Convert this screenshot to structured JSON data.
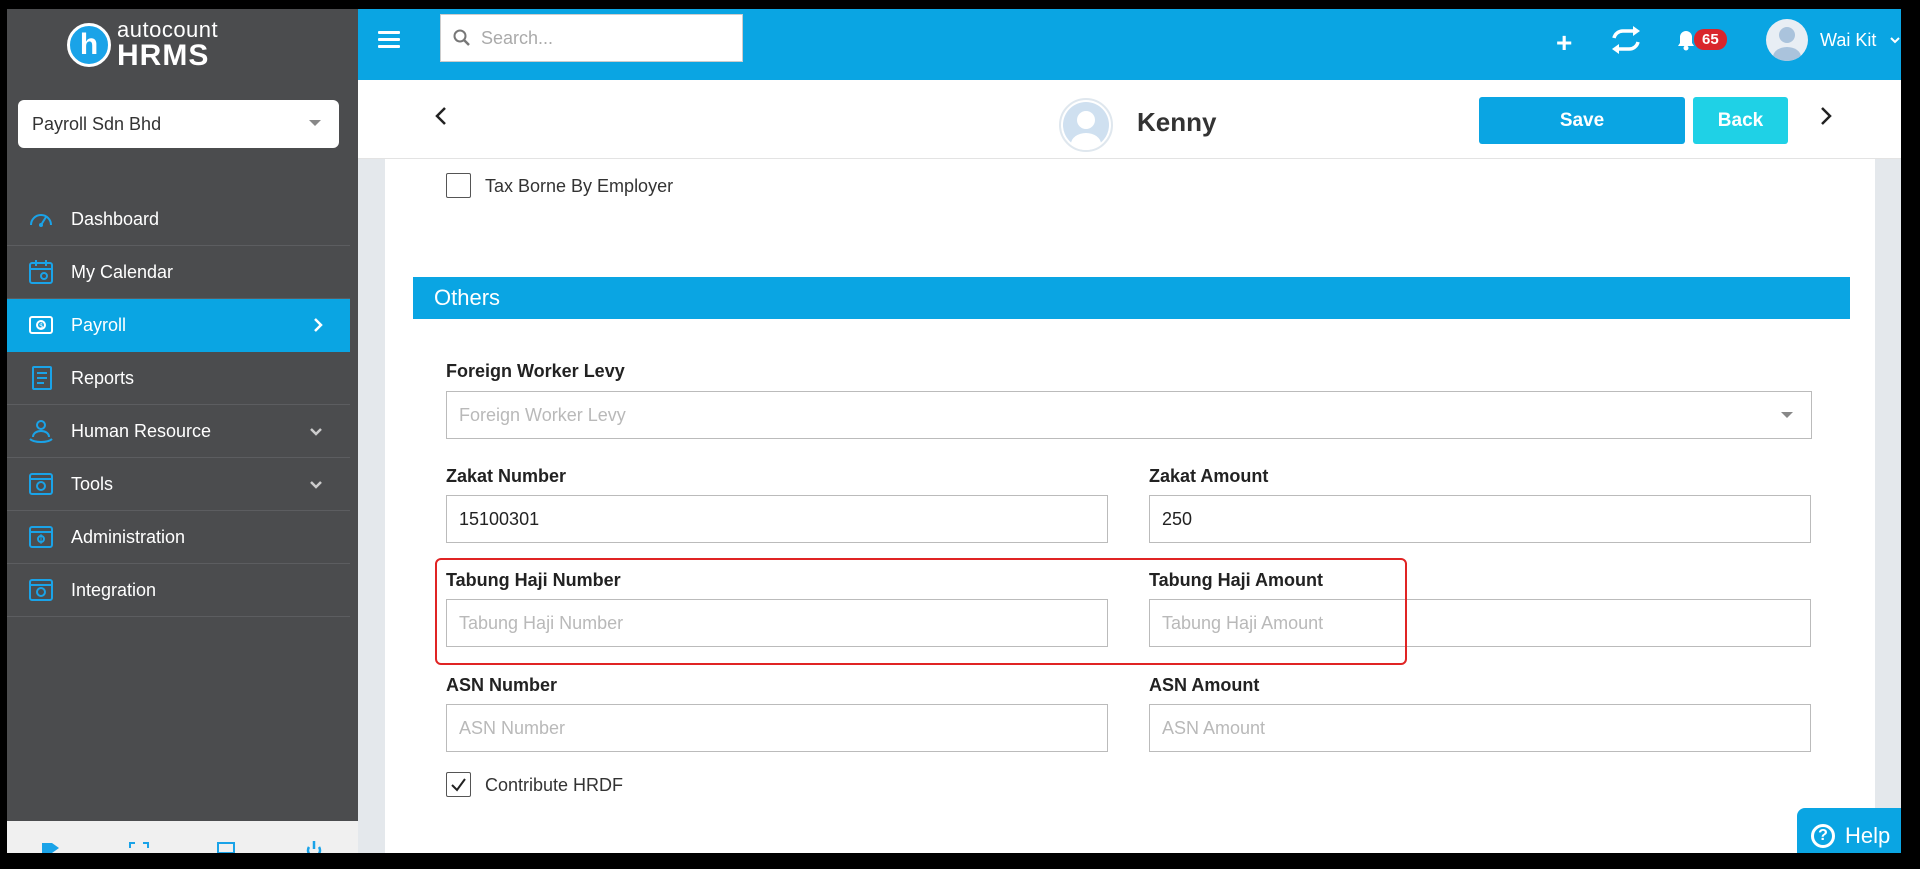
{
  "logo": {
    "top": "autocount",
    "bottom": "HRMS",
    "mark": "h"
  },
  "company": "Payroll Sdn Bhd",
  "nav": [
    {
      "label": "Dashboard",
      "icon": "dashboard-icon"
    },
    {
      "label": "My Calendar",
      "icon": "calendar-icon"
    },
    {
      "label": "Payroll",
      "icon": "payroll-icon",
      "active": true
    },
    {
      "label": "Reports",
      "icon": "reports-icon"
    },
    {
      "label": "Human Resource",
      "icon": "human-resource-icon"
    },
    {
      "label": "Tools",
      "icon": "tools-icon"
    },
    {
      "label": "Administration",
      "icon": "administration-icon"
    },
    {
      "label": "Integration",
      "icon": "integration-icon"
    }
  ],
  "topbar": {
    "search_placeholder": "Search...",
    "notification_count": "65",
    "user_name": "Wai Kit"
  },
  "employee": {
    "name": "Kenny"
  },
  "actions": {
    "save": "Save",
    "back": "Back"
  },
  "form": {
    "tax_borne_label": "Tax Borne By Employer",
    "tax_borne_checked": false,
    "section_title": "Others",
    "foreign_levy": {
      "label": "Foreign Worker Levy",
      "placeholder": "Foreign Worker Levy",
      "value": ""
    },
    "zakat_number": {
      "label": "Zakat Number",
      "value": "15100301"
    },
    "zakat_amount": {
      "label": "Zakat Amount",
      "value": "250"
    },
    "tabung_number": {
      "label": "Tabung Haji Number",
      "placeholder": "Tabung Haji Number",
      "value": ""
    },
    "tabung_amount": {
      "label": "Tabung Haji Amount",
      "placeholder": "Tabung Haji Amount",
      "value": ""
    },
    "asn_number": {
      "label": "ASN Number",
      "placeholder": "ASN Number",
      "value": ""
    },
    "asn_amount": {
      "label": "ASN Amount",
      "placeholder": "ASN Amount",
      "value": ""
    },
    "hrdf_label": "Contribute HRDF",
    "hrdf_checked": true
  },
  "help": {
    "label": "Help"
  },
  "colors": {
    "primary": "#0aa5e3",
    "sidebar": "#4b4c4e",
    "accent": "#1fd1e6",
    "badge": "#d9262c",
    "highlight": "#e02424"
  }
}
